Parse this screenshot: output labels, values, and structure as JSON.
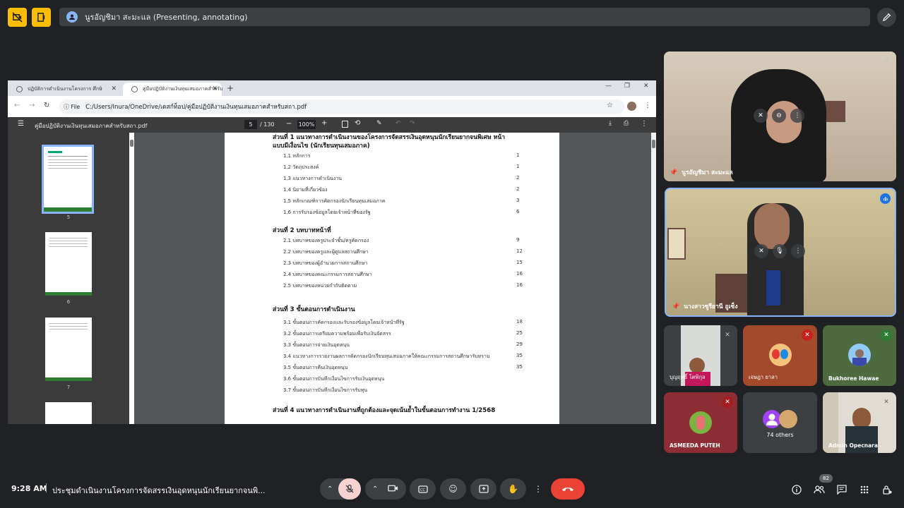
{
  "top": {
    "presenter_label": "นูรอัญชิมา สะมะแล (Presenting, annotating)"
  },
  "browser": {
    "tabs": [
      {
        "title": "ปฏิบัติการดำเนินงานโครงการ ศึกษิ"
      },
      {
        "title": "คู่มือปฏิบัติงานเงินทุนเสมอภาคสำหรับ"
      }
    ],
    "address_scheme": "File",
    "address": "C:/Users/Inura/OneDrive/เดสก์ท็อป/คู่มือปฏิบัติงานเงินทุนเสมอภาคสำหรับสถา.pdf",
    "pdf": {
      "filename": "คู่มือปฏิบัติงานเงินทุนเสมอภาคสำหรับสถา.pdf",
      "page_current": "5",
      "page_total": "/ 130",
      "zoom": "100%"
    },
    "thumbnails": [
      "5",
      "6",
      "7"
    ],
    "toc": {
      "sections": [
        {
          "title": "ส่วนที่ 1 แนวทางการดำเนินงานของโครงการจัดสรรเงินอุดหนุนนักเรียนยากจนพิเศษ  หน้า",
          "subtitle": "แบบมีเงื่อนไข (นักเรียนทุนเสมอภาค)",
          "items": [
            {
              "label": "1.1 หลักการ",
              "page": "1"
            },
            {
              "label": "1.2 วัตถุประสงค์",
              "page": "1"
            },
            {
              "label": "1.3 แนวทางการดำเนินงาน",
              "page": "2"
            },
            {
              "label": "1.4 นิยามที่เกี่ยวข้อง",
              "page": "2"
            },
            {
              "label": "1.5 หลักเกณฑ์การคัดกรองนักเรียนทุนเสมอภาค",
              "page": "3"
            },
            {
              "label": "1.6 การรับรองข้อมูลโดยเจ้าหน้าที่ของรัฐ",
              "page": "6"
            }
          ]
        },
        {
          "title": "ส่วนที่ 2 บทบาทหน้าที่",
          "items": [
            {
              "label": "2.1 บทบาทของครูประจำชั้น/ครูคัดกรอง",
              "page": "9"
            },
            {
              "label": "2.2 บทบาทของครูและผู้ดูแลสถานศึกษา",
              "page": "12"
            },
            {
              "label": "2.3 บทบาทของผู้อำนวยการสถานศึกษา",
              "page": "15"
            },
            {
              "label": "2.4 บทบาทของคณะกรรมการสถานศึกษา",
              "page": "16"
            },
            {
              "label": "2.5 บทบาทของหน่วยกำกับติดตาม",
              "page": "16"
            }
          ]
        },
        {
          "title": "ส่วนที่ 3 ขั้นตอนการดำเนินงาน",
          "items": [
            {
              "label": "3.1 ขั้นตอนการคัดกรองและรับรองข้อมูลโดยเจ้าหน้าที่รัฐ",
              "page": "18"
            },
            {
              "label": "3.2 ขั้นตอนการเตรียมความพร้อมเพื่อรับเงินจัดสรร",
              "page": "25"
            },
            {
              "label": "3.3 ขั้นตอนการจ่ายเงินอุดหนุน",
              "page": "29"
            },
            {
              "label": "3.4 แนวทางการรายงานผลการคัดกรองนักเรียนทุนเสมอภาคให้คณะกรรมการสถานศึกษารับทราบ",
              "page": "35"
            },
            {
              "label": "3.5 ขั้นตอนการคืนเงินอุดหนุน",
              "page": "35"
            },
            {
              "label": "3.6 ขั้นตอนการบันทึกเงื่อนไขการรับเงินอุดหนุน",
              "page": ""
            },
            {
              "label": "3.7 ขั้นตอนการบันทึกเงื่อนไขการรับทุน",
              "page": ""
            }
          ]
        },
        {
          "title": "ส่วนที่ 4 แนวทางการดำเนินงานที่ถูกต้องและจุดเน้นย้ำในขั้นตอนการทำงาน 1/2568",
          "items": []
        }
      ]
    }
  },
  "participants": {
    "presenter": {
      "name": "นูรอัญชิมา สะมะแล"
    },
    "speaker": {
      "name": "นางสาวซูรียานี อูเซ็ง"
    },
    "grid": [
      {
        "name": "บุญฤทธิ์ โตพิกุล"
      },
      {
        "name": "เจษฎา ยาลา"
      },
      {
        "name": "Bukhoree Hawae"
      },
      {
        "name": "ASMEEDA PUTEH"
      },
      {
        "name": "74 others"
      },
      {
        "name": "Admin Opecnara"
      }
    ]
  },
  "bottom": {
    "time": "9:28 AM",
    "meeting_title": "ประชุมดำเนินงานโครงการจัดสรรเงินอุดหนุนนักเรียนยากจนพิ...",
    "people_count": "82"
  }
}
